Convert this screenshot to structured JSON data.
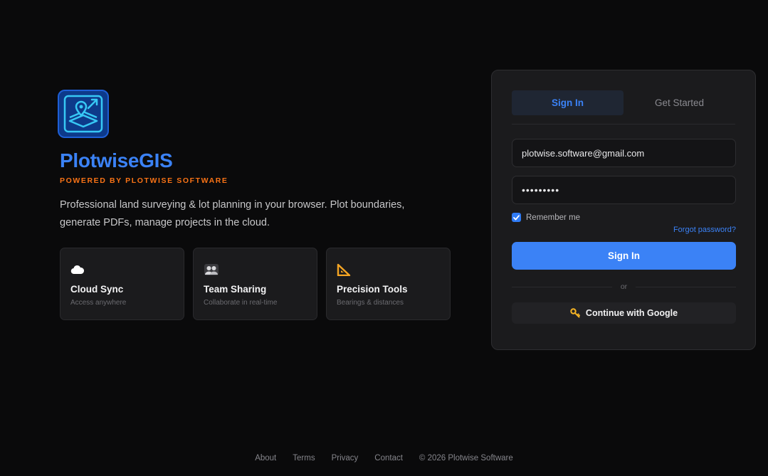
{
  "brand": {
    "name": "PlotwiseGIS",
    "tagline": "POWERED BY PLOTWISE SOFTWARE",
    "description": "Professional land surveying & lot planning in your browser. Plot boundaries, generate PDFs, manage projects in the cloud.",
    "logo_icon": "map-pin-layers-icon",
    "colors": {
      "primary": "#3b82f6",
      "accent": "#f97316",
      "background": "#0a0a0b"
    }
  },
  "features": [
    {
      "icon": "cloud-icon",
      "title": "Cloud Sync",
      "subtitle": "Access anywhere"
    },
    {
      "icon": "team-icon",
      "title": "Team Sharing",
      "subtitle": "Collaborate in real-time"
    },
    {
      "icon": "triangle-ruler-icon",
      "title": "Precision Tools",
      "subtitle": "Bearings & distances"
    }
  ],
  "auth": {
    "tabs": [
      {
        "label": "Sign In",
        "active": true
      },
      {
        "label": "Get Started",
        "active": false
      }
    ],
    "email_value": "plotwise.software@gmail.com",
    "password_value": "•••••••••",
    "remember_label": "Remember me",
    "remember_checked": true,
    "forgot_label": "Forgot password?",
    "submit_label": "Sign In",
    "divider_label": "or",
    "google_label": "Continue with Google",
    "google_icon": "key-icon"
  },
  "footer": {
    "links": [
      "About",
      "Terms",
      "Privacy",
      "Contact"
    ],
    "copyright": "© 2026 Plotwise Software"
  }
}
